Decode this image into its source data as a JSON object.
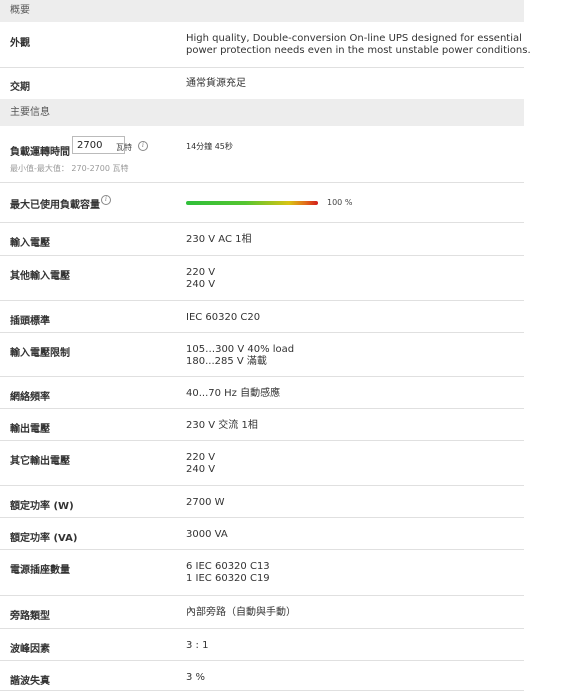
{
  "overview": {
    "header": "概要",
    "appearance_label": "外觀",
    "appearance_line1": "High quality, Double-conversion On-line UPS designed for essential",
    "appearance_line2": "power protection needs even in the most unstable power conditions.",
    "delivery_label": "交期",
    "delivery_value": "通常貨源充足"
  },
  "main_info": {
    "header": "主要信息",
    "runtime_label": "負載運轉時間",
    "runtime_input_value": "2700",
    "runtime_unit": "瓦特",
    "runtime_hint": "最小值-最大值： 270-2700 瓦特",
    "runtime_result": "14分鐘 45秒",
    "max_load_label": "最大已使用負載容量",
    "max_load_percent_value": 100,
    "max_load_percent_text": "100 %"
  },
  "specs": [
    {
      "label": "輸入電壓",
      "lines": [
        "230 V AC 1相"
      ]
    },
    {
      "label": "其他輸入電壓",
      "lines": [
        "220 V",
        "240 V"
      ]
    },
    {
      "label": "插頭標準",
      "lines": [
        "IEC 60320 C20"
      ]
    },
    {
      "label": "輸入電壓限制",
      "lines": [
        "105…300 V 40% load",
        "180...285 V 滿載"
      ]
    },
    {
      "label": "網絡頻率",
      "lines": [
        "40...70 Hz 自動感應"
      ]
    },
    {
      "label": "輸出電壓",
      "lines": [
        "230 V 交流 1相"
      ]
    },
    {
      "label": "其它輸出電壓",
      "lines": [
        "220 V",
        "240 V"
      ]
    },
    {
      "label": "額定功率 (W)",
      "lines": [
        "2700 W"
      ]
    },
    {
      "label": "額定功率 (VA)",
      "lines": [
        "3000 VA"
      ]
    },
    {
      "label": "電源插座數量",
      "lines": [
        "6 IEC 60320 C13",
        "1 IEC 60320 C19"
      ]
    },
    {
      "label": "旁路類型",
      "lines": [
        "內部旁路（自動與手動）"
      ]
    },
    {
      "label": "波峰因素",
      "lines": [
        "3 : 1"
      ]
    },
    {
      "label": "諧波失真",
      "lines": [
        "3 %"
      ]
    }
  ],
  "icons": {
    "info": "info-icon"
  }
}
